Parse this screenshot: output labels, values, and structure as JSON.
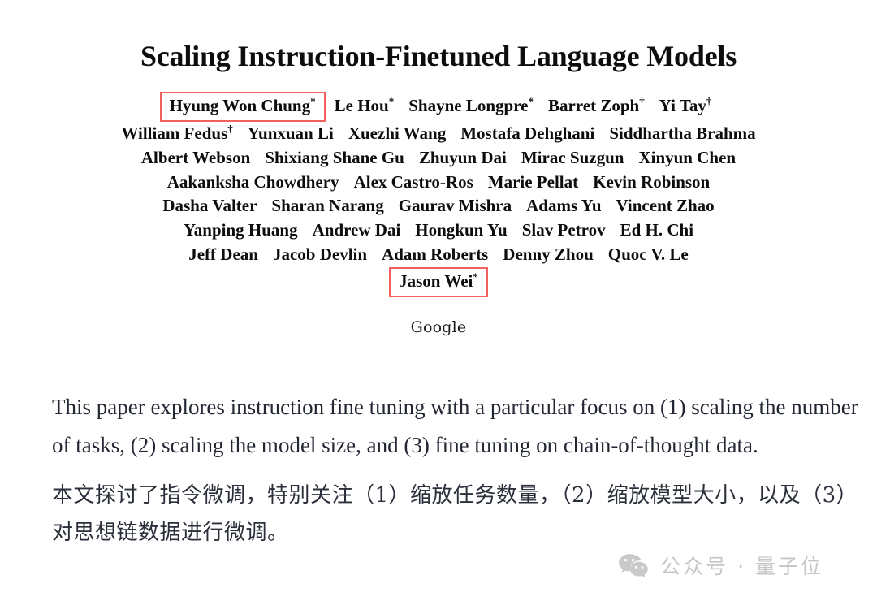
{
  "paper": {
    "title": "Scaling Instruction-Finetuned Language Models",
    "affiliation": "Google",
    "author_lines": [
      [
        {
          "name": "Hyung Won Chung",
          "mark": "*",
          "highlighted": true
        },
        {
          "name": "Le Hou",
          "mark": "*",
          "highlighted": false
        },
        {
          "name": "Shayne Longpre",
          "mark": "*",
          "highlighted": false
        },
        {
          "name": "Barret Zoph",
          "mark": "†",
          "highlighted": false
        },
        {
          "name": "Yi Tay",
          "mark": "†",
          "highlighted": false
        }
      ],
      [
        {
          "name": "William Fedus",
          "mark": "†",
          "highlighted": false
        },
        {
          "name": "Yunxuan Li",
          "mark": "",
          "highlighted": false
        },
        {
          "name": "Xuezhi Wang",
          "mark": "",
          "highlighted": false
        },
        {
          "name": "Mostafa Dehghani",
          "mark": "",
          "highlighted": false
        },
        {
          "name": "Siddhartha Brahma",
          "mark": "",
          "highlighted": false
        }
      ],
      [
        {
          "name": "Albert Webson",
          "mark": "",
          "highlighted": false
        },
        {
          "name": "Shixiang Shane Gu",
          "mark": "",
          "highlighted": false
        },
        {
          "name": "Zhuyun Dai",
          "mark": "",
          "highlighted": false
        },
        {
          "name": "Mirac Suzgun",
          "mark": "",
          "highlighted": false
        },
        {
          "name": "Xinyun Chen",
          "mark": "",
          "highlighted": false
        }
      ],
      [
        {
          "name": "Aakanksha Chowdhery",
          "mark": "",
          "highlighted": false
        },
        {
          "name": "Alex Castro-Ros",
          "mark": "",
          "highlighted": false
        },
        {
          "name": "Marie Pellat",
          "mark": "",
          "highlighted": false
        },
        {
          "name": "Kevin Robinson",
          "mark": "",
          "highlighted": false
        }
      ],
      [
        {
          "name": "Dasha Valter",
          "mark": "",
          "highlighted": false
        },
        {
          "name": "Sharan Narang",
          "mark": "",
          "highlighted": false
        },
        {
          "name": "Gaurav Mishra",
          "mark": "",
          "highlighted": false
        },
        {
          "name": "Adams Yu",
          "mark": "",
          "highlighted": false
        },
        {
          "name": "Vincent Zhao",
          "mark": "",
          "highlighted": false
        }
      ],
      [
        {
          "name": "Yanping Huang",
          "mark": "",
          "highlighted": false
        },
        {
          "name": "Andrew Dai",
          "mark": "",
          "highlighted": false
        },
        {
          "name": "Hongkun Yu",
          "mark": "",
          "highlighted": false
        },
        {
          "name": "Slav Petrov",
          "mark": "",
          "highlighted": false
        },
        {
          "name": "Ed H. Chi",
          "mark": "",
          "highlighted": false
        }
      ],
      [
        {
          "name": "Jeff Dean",
          "mark": "",
          "highlighted": false
        },
        {
          "name": "Jacob Devlin",
          "mark": "",
          "highlighted": false
        },
        {
          "name": "Adam Roberts",
          "mark": "",
          "highlighted": false
        },
        {
          "name": "Denny Zhou",
          "mark": "",
          "highlighted": false
        },
        {
          "name": "Quoc V. Le",
          "mark": "",
          "highlighted": false
        }
      ],
      [
        {
          "name": "Jason Wei",
          "mark": "*",
          "highlighted": true
        }
      ]
    ]
  },
  "body": {
    "paragraph_en": "This paper explores instruction fine tuning with a particular focus on (1) scaling the number of tasks, (2) scaling the model size, and (3) fine tuning on chain-of-thought data.",
    "paragraph_zh": "本文探讨了指令微调，特别关注（1）缩放任务数量，（2）缩放模型大小，以及（3）对思想链数据进行微调。"
  },
  "watermark": {
    "icon": "wechat-icon",
    "text": "公众号 · 量子位",
    "color": "#c6c6c6"
  },
  "colors": {
    "highlight_box": "#f4605d",
    "page_background": "#ffffff",
    "title_text": "#0d0d0d",
    "body_text": "#222733"
  }
}
